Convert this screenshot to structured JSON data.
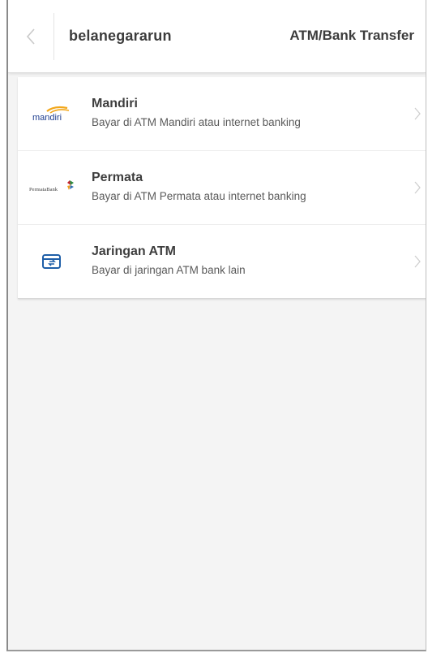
{
  "header": {
    "merchant_name": "belanegararun",
    "page_title": "ATM/Bank Transfer"
  },
  "payment_methods": [
    {
      "name": "Mandiri",
      "description": "Bayar di ATM Mandiri atau internet banking",
      "logo_text": "mandiri",
      "icon": "mandiri-logo"
    },
    {
      "name": "Permata",
      "description": "Bayar di ATM Permata atau internet banking",
      "logo_text": "PermataBank",
      "icon": "permata-logo"
    },
    {
      "name": "Jaringan ATM",
      "description": "Bayar di jaringan ATM bank lain",
      "icon": "atm-card-icon"
    }
  ],
  "colors": {
    "accent": "#1f5fa8",
    "mandiri_blue": "#1e3d8f",
    "mandiri_gold": "#f2a71b",
    "permata_red": "#c8202f",
    "permata_green": "#2e8b3e"
  }
}
